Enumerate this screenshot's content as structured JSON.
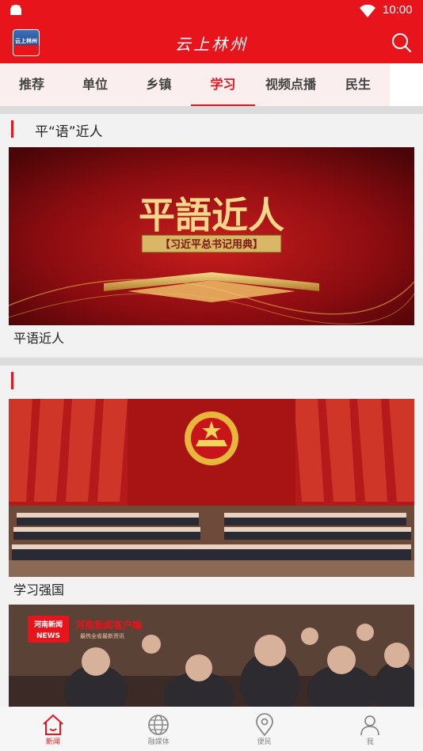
{
  "status_bar": {
    "time": "10:00",
    "android_icon": "android-icon",
    "wifi_icon": "wifi-icon"
  },
  "header": {
    "title": "云上林州",
    "logo_text": "云上林州",
    "search_icon": "search-icon"
  },
  "tabs": [
    {
      "label": "推荐",
      "active": false
    },
    {
      "label": "单位",
      "active": false
    },
    {
      "label": "乡镇",
      "active": false
    },
    {
      "label": "学习",
      "active": true
    },
    {
      "label": "视频点播",
      "active": false
    },
    {
      "label": "民生",
      "active": false
    }
  ],
  "sections": [
    {
      "title": "平“语”近人",
      "cards": [
        {
          "image_title": "平語近人",
          "image_subtitle": "【习近平总书记用典】",
          "caption": "平语近人"
        }
      ]
    },
    {
      "title": "",
      "cards": [
        {
          "caption": "学习强国"
        },
        {
          "image_badge_line1": "河南新闻",
          "image_badge_line2": "NEWS",
          "image_banner": "河南新闻客户端",
          "image_banner_sub": "最热全省最新资讯"
        }
      ]
    }
  ],
  "bottom_nav": [
    {
      "label": "新闻",
      "icon": "home-icon",
      "active": true
    },
    {
      "label": "融媒体",
      "icon": "globe-icon",
      "active": false
    },
    {
      "label": "便民",
      "icon": "location-pin-icon",
      "active": false
    },
    {
      "label": "我",
      "icon": "user-icon",
      "active": false
    }
  ],
  "colors": {
    "brand_red": "#e8141c",
    "tab_bg": "#fbeeee",
    "nav_inactive": "#888888"
  }
}
